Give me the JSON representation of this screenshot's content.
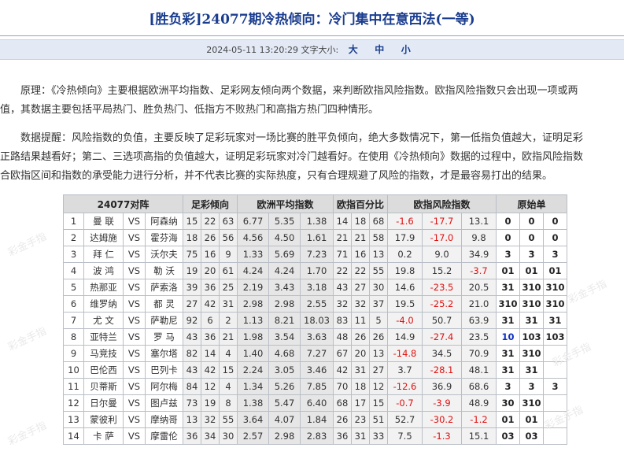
{
  "title": "[胜负彩]24077期冷热倾向：冷门集中在意西法(一等)",
  "infobar": {
    "datetime": "2024-05-11 13:20:29",
    "font_label": "文字大小:",
    "sizes": [
      "大",
      "中",
      "小"
    ]
  },
  "paragraph1": [
    "原理：《冷热倾向》主要根据欧洲平均指数、足彩网友倾向两个数据，来判断欧指风险指数。欧指风险指数只会出现一项或两",
    "值，其数据主要包括平局热门、胜负热门、低指方不败热门和高指方热门四种情形。"
  ],
  "paragraph2": [
    "数据提醒：风险指数的负值，主要反映了足彩玩家对一场比赛的胜平负倾向，绝大多数情况下，第一低指负值越大，证明足彩",
    "正路结果越看好；第二、三选项高指的负值越大，证明足彩玩家对冷门越看好。在使用《冷热倾向》数据的过程中，欧指风险指数",
    "合欧指区间和指数的承受能力进行分析，并不代表比赛的实际热度，只有合理规避了风险的指数，才是最容易打出的结果。"
  ],
  "table": {
    "headers": [
      "24077对阵",
      "足彩倾向",
      "欧洲平均指数",
      "欧指百分比",
      "欧指风险指数",
      "原始单"
    ],
    "rows": [
      {
        "no": "1",
        "home": "曼 联",
        "vs": "VS",
        "away": "阿森纳",
        "fc": [
          "15",
          "22",
          "63"
        ],
        "oz": [
          "6.77",
          "5.35",
          "1.38"
        ],
        "bf": [
          "14",
          "18",
          "68"
        ],
        "rk": [
          "-1.6",
          "-17.7",
          "13.1"
        ],
        "ys": [
          "0",
          "0",
          "0"
        ]
      },
      {
        "no": "2",
        "home": "达姆施",
        "vs": "VS",
        "away": "霍芬海",
        "fc": [
          "18",
          "26",
          "56"
        ],
        "oz": [
          "4.56",
          "4.50",
          "1.61"
        ],
        "bf": [
          "21",
          "21",
          "58"
        ],
        "rk": [
          "17.9",
          "-17.0",
          "9.8"
        ],
        "ys": [
          "0",
          "0",
          "0"
        ]
      },
      {
        "no": "3",
        "home": "拜 仁",
        "vs": "VS",
        "away": "沃尔夫",
        "fc": [
          "75",
          "16",
          "9"
        ],
        "oz": [
          "1.33",
          "5.69",
          "7.23"
        ],
        "bf": [
          "71",
          "16",
          "13"
        ],
        "rk": [
          "0.2",
          "9.0",
          "34.9"
        ],
        "ys": [
          "3",
          "3",
          "3"
        ]
      },
      {
        "no": "4",
        "home": "波 鸿",
        "vs": "VS",
        "away": "勒 沃",
        "fc": [
          "19",
          "20",
          "61"
        ],
        "oz": [
          "4.24",
          "4.24",
          "1.70"
        ],
        "bf": [
          "22",
          "22",
          "55"
        ],
        "rk": [
          "19.8",
          "15.2",
          "-3.7"
        ],
        "ys": [
          "01",
          "01",
          "01"
        ]
      },
      {
        "no": "5",
        "home": "热那亚",
        "vs": "VS",
        "away": "萨索洛",
        "fc": [
          "39",
          "36",
          "25"
        ],
        "oz": [
          "2.19",
          "3.43",
          "3.18"
        ],
        "bf": [
          "43",
          "27",
          "30"
        ],
        "rk": [
          "14.6",
          "-23.5",
          "20.5"
        ],
        "ys": [
          "31",
          "310",
          "310"
        ]
      },
      {
        "no": "6",
        "home": "维罗纳",
        "vs": "VS",
        "away": "都 灵",
        "fc": [
          "27",
          "42",
          "31"
        ],
        "oz": [
          "2.98",
          "2.98",
          "2.55"
        ],
        "bf": [
          "32",
          "32",
          "37"
        ],
        "rk": [
          "19.5",
          "-25.2",
          "21.0"
        ],
        "ys": [
          "310",
          "310",
          "310"
        ]
      },
      {
        "no": "7",
        "home": "尤 文",
        "vs": "VS",
        "away": "萨勒尼",
        "fc": [
          "92",
          "6",
          "2"
        ],
        "oz": [
          "1.13",
          "8.21",
          "18.03"
        ],
        "bf": [
          "83",
          "11",
          "5"
        ],
        "rk": [
          "-4.0",
          "50.7",
          "63.9"
        ],
        "ys": [
          "31",
          "31",
          "31"
        ]
      },
      {
        "no": "8",
        "home": "亚特兰",
        "vs": "VS",
        "away": "罗 马",
        "fc": [
          "43",
          "36",
          "21"
        ],
        "oz": [
          "1.98",
          "3.54",
          "3.63"
        ],
        "bf": [
          "48",
          "26",
          "26"
        ],
        "rk": [
          "14.9",
          "-27.4",
          "23.5"
        ],
        "ys": [
          "10",
          "103",
          "103"
        ]
      },
      {
        "no": "9",
        "home": "马竞技",
        "vs": "VS",
        "away": "塞尔塔",
        "fc": [
          "82",
          "14",
          "4"
        ],
        "oz": [
          "1.40",
          "4.68",
          "7.27"
        ],
        "bf": [
          "67",
          "20",
          "13"
        ],
        "rk": [
          "-14.8",
          "34.5",
          "70.9"
        ],
        "ys": [
          "31",
          "310",
          ""
        ]
      },
      {
        "no": "10",
        "home": "巴伦西",
        "vs": "VS",
        "away": "巴列卡",
        "fc": [
          "43",
          "42",
          "15"
        ],
        "oz": [
          "2.24",
          "3.05",
          "3.46"
        ],
        "bf": [
          "42",
          "31",
          "27"
        ],
        "rk": [
          "3.7",
          "-28.1",
          "48.1"
        ],
        "ys": [
          "31",
          "31",
          ""
        ]
      },
      {
        "no": "11",
        "home": "贝蒂斯",
        "vs": "VS",
        "away": "阿尔梅",
        "fc": [
          "84",
          "12",
          "4"
        ],
        "oz": [
          "1.34",
          "5.26",
          "7.85"
        ],
        "bf": [
          "70",
          "18",
          "12"
        ],
        "rk": [
          "-12.6",
          "36.9",
          "68.6"
        ],
        "ys": [
          "3",
          "3",
          "3"
        ]
      },
      {
        "no": "12",
        "home": "日尔曼",
        "vs": "VS",
        "away": "图卢兹",
        "fc": [
          "73",
          "19",
          "8"
        ],
        "oz": [
          "1.38",
          "5.47",
          "6.40"
        ],
        "bf": [
          "68",
          "17",
          "15"
        ],
        "rk": [
          "-0.7",
          "-3.9",
          "48.9"
        ],
        "ys": [
          "30",
          "310",
          ""
        ]
      },
      {
        "no": "13",
        "home": "蒙彼利",
        "vs": "VS",
        "away": "摩纳哥",
        "fc": [
          "13",
          "32",
          "55"
        ],
        "oz": [
          "3.64",
          "4.07",
          "1.84"
        ],
        "bf": [
          "26",
          "23",
          "51"
        ],
        "rk": [
          "52.7",
          "-30.2",
          "-1.2"
        ],
        "ys": [
          "01",
          "01",
          ""
        ]
      },
      {
        "no": "14",
        "home": "卡 萨",
        "vs": "VS",
        "away": "摩雷伦",
        "fc": [
          "36",
          "34",
          "30"
        ],
        "oz": [
          "2.57",
          "2.98",
          "2.83"
        ],
        "bf": [
          "36",
          "31",
          "33"
        ],
        "rk": [
          "7.5",
          "-1.3",
          "15.1"
        ],
        "ys": [
          "03",
          "03",
          ""
        ]
      }
    ]
  },
  "colors": {
    "negative": "#e01010",
    "highlight": "#1030c0",
    "title": "#1a3d8f"
  },
  "watermark": "彩金手指"
}
